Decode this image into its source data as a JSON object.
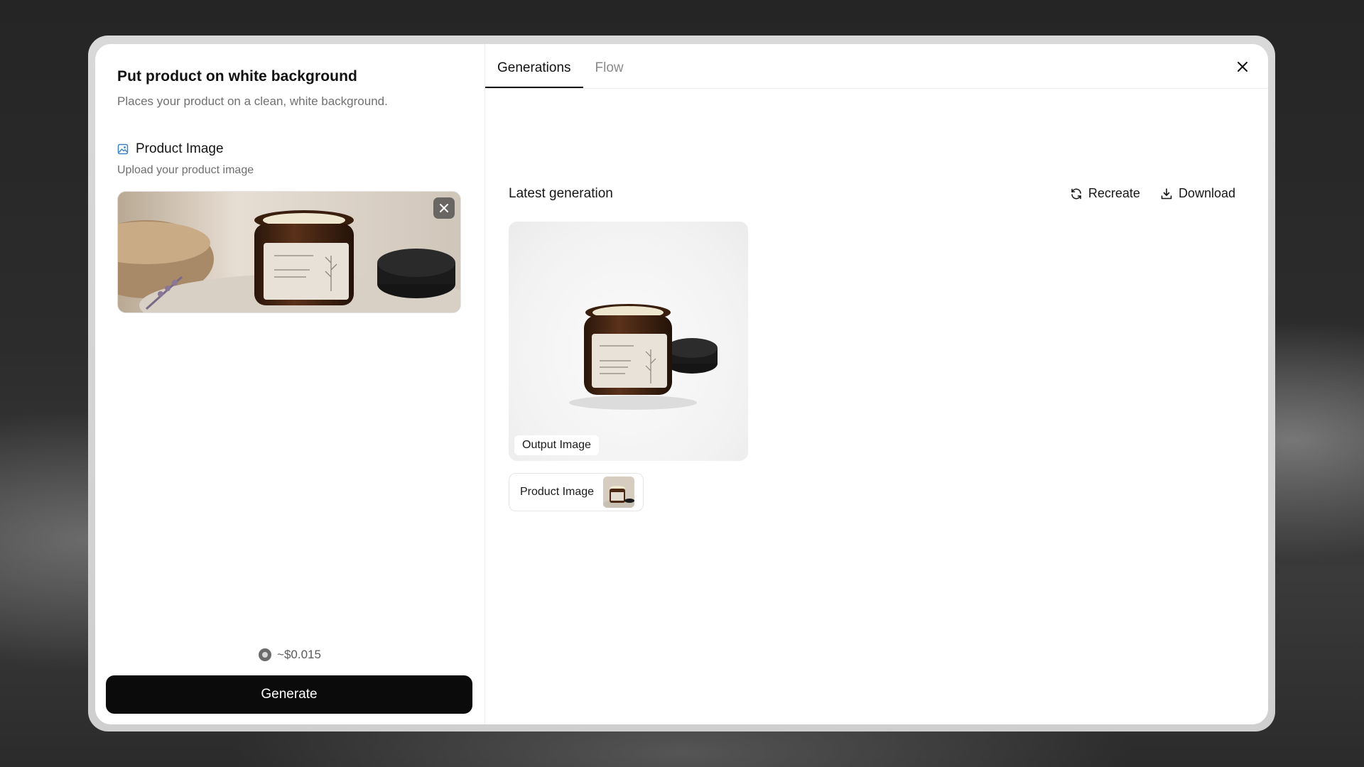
{
  "panel": {
    "title": "Put product on white background",
    "subtitle": "Places your product on a clean, white background."
  },
  "field": {
    "label": "Product Image",
    "hint": "Upload your product image",
    "icon": "image-icon"
  },
  "cost": {
    "text": "~$0.015",
    "icon": "credit-icon"
  },
  "generate_label": "Generate",
  "tabs": [
    {
      "label": "Generations",
      "active": true
    },
    {
      "label": "Flow",
      "active": false
    }
  ],
  "latest": {
    "title": "Latest generation",
    "recreate_label": "Recreate",
    "download_label": "Download",
    "output_tag": "Output Image",
    "input_chip_label": "Product Image"
  },
  "colors": {
    "accent_icon": "#3b82c4",
    "generate_bg": "#0b0b0b",
    "jar_amber": "#3a1f10"
  }
}
